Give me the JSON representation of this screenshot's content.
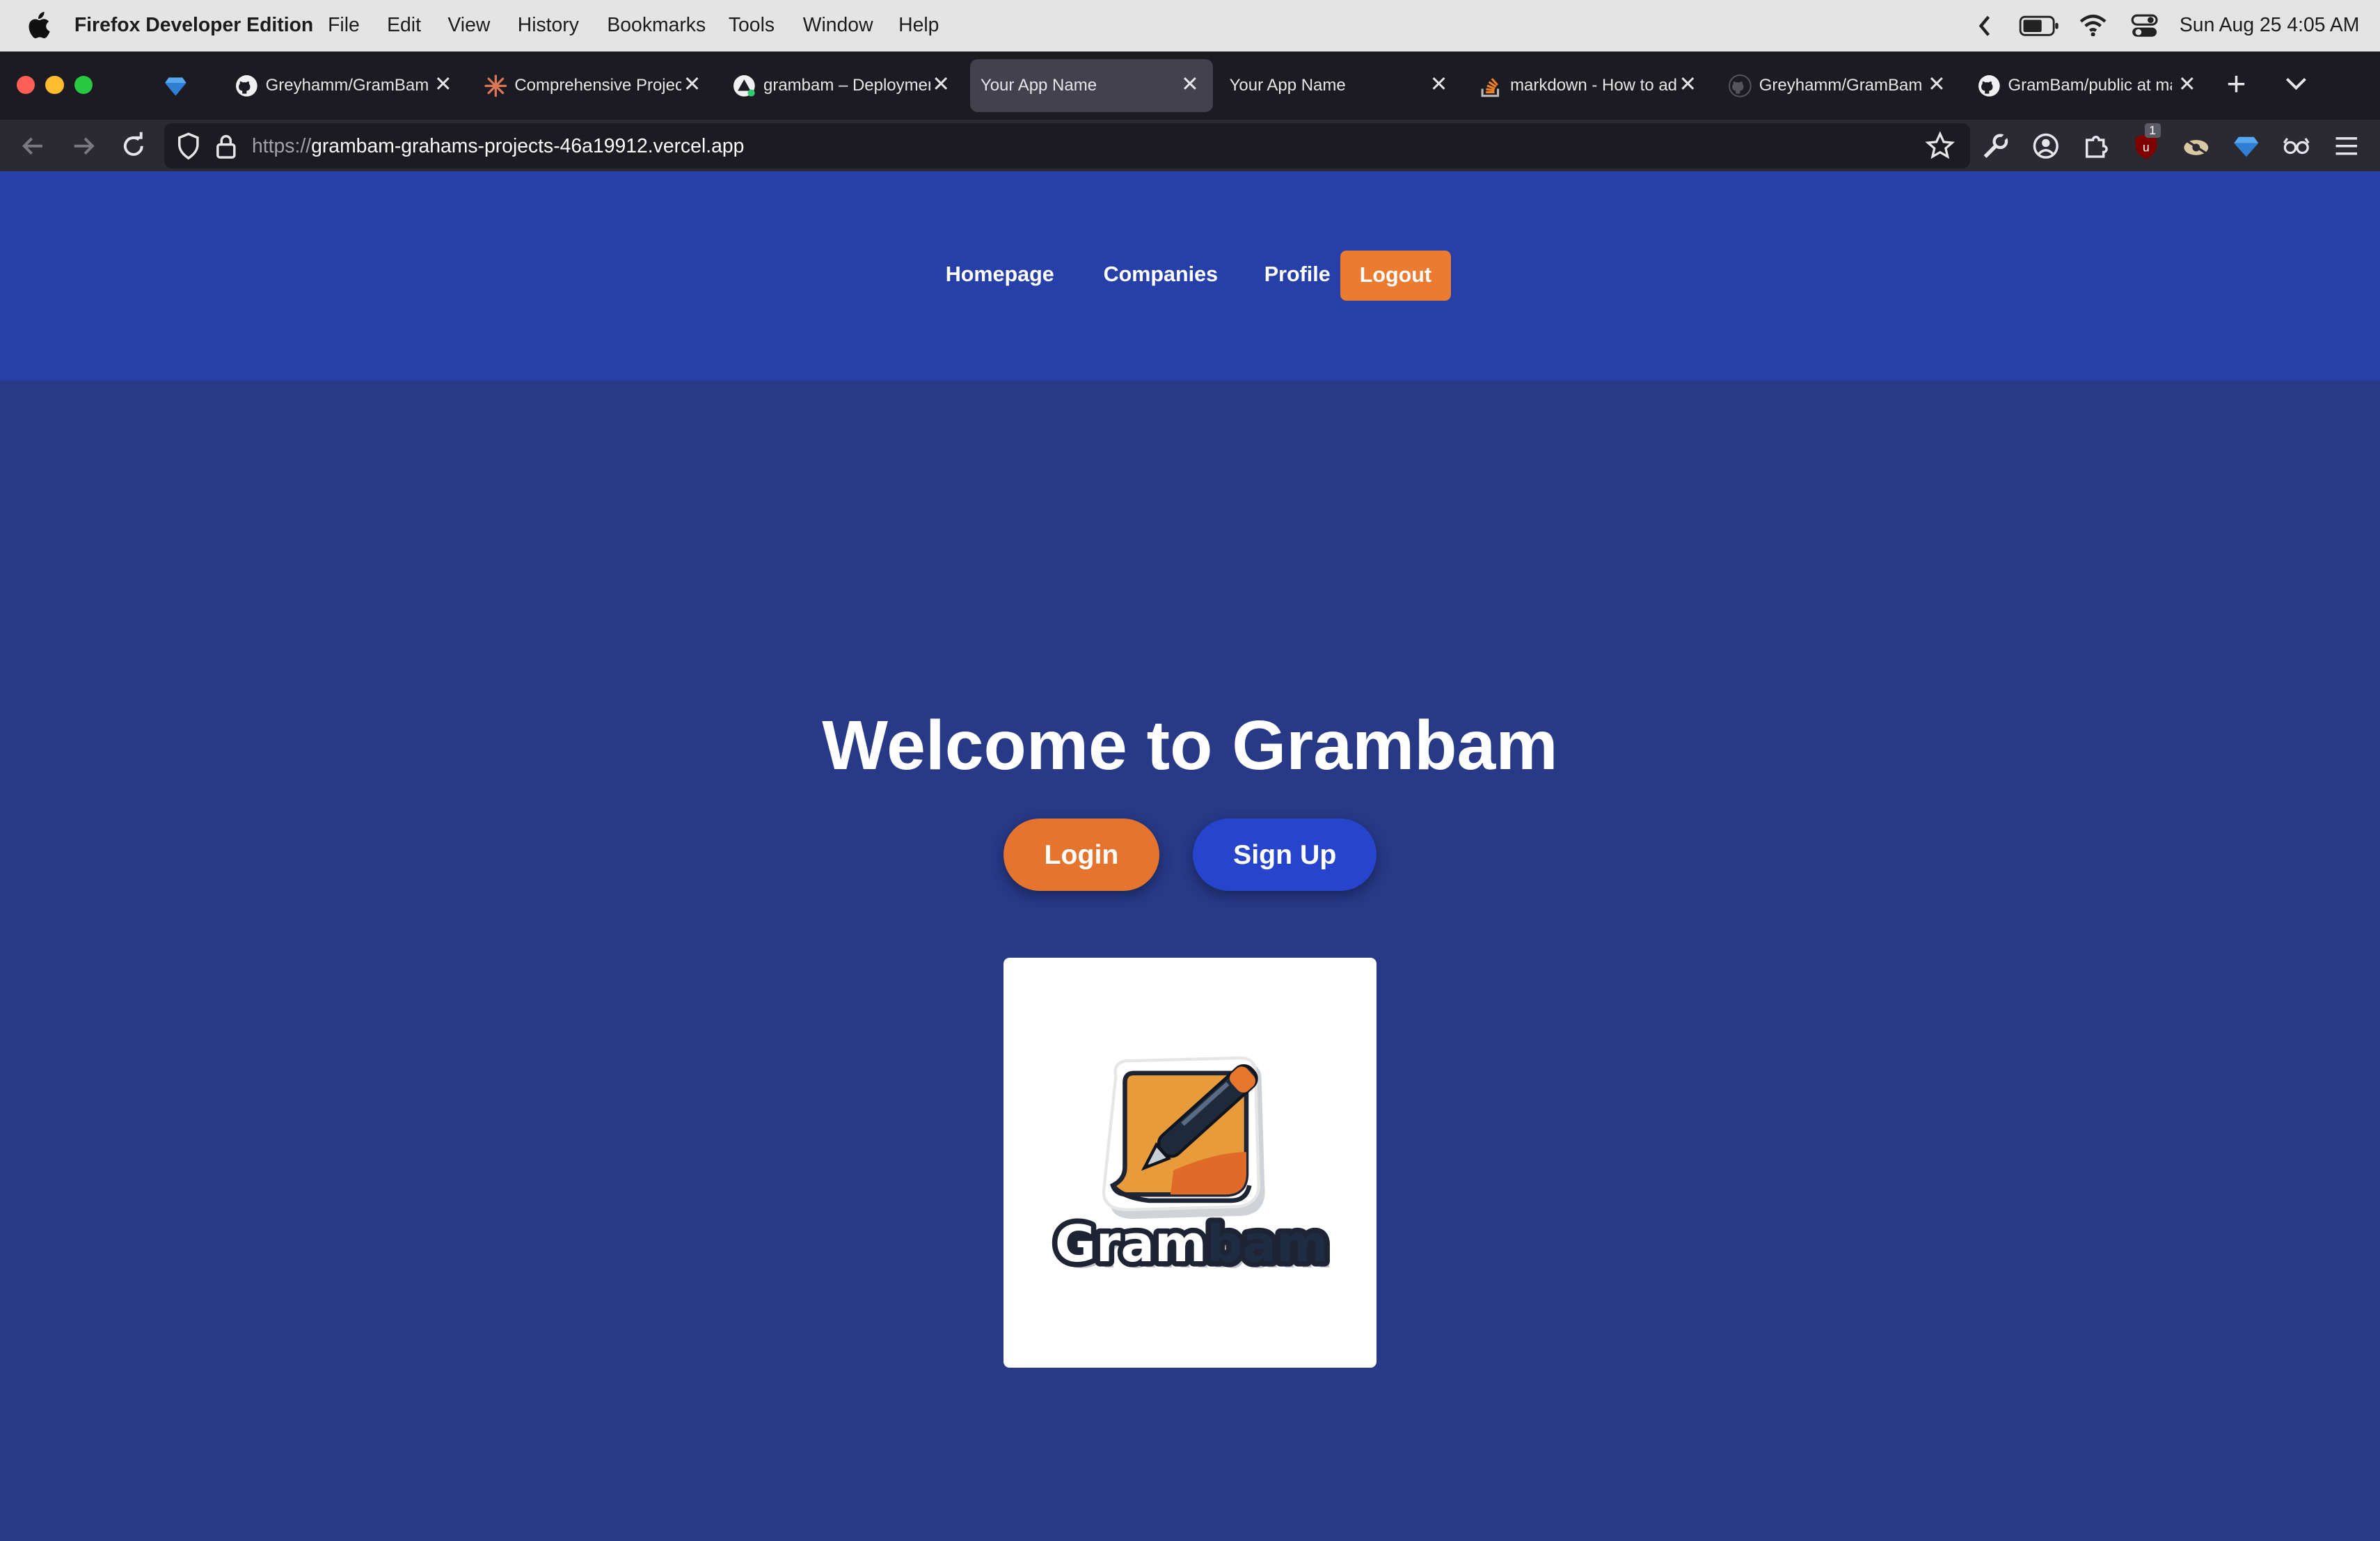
{
  "menubar": {
    "app_name": "Firefox Developer Edition",
    "items": [
      "File",
      "Edit",
      "View",
      "History",
      "Bookmarks",
      "Tools",
      "Window",
      "Help"
    ],
    "clock": "Sun Aug 25  4:05 AM"
  },
  "tabs": [
    {
      "label": "",
      "icon": "gem-icon",
      "active": false
    },
    {
      "label": "Greyhamm/GramBam",
      "icon": "github-icon",
      "active": false
    },
    {
      "label": "Comprehensive Project",
      "icon": "sparkle-icon",
      "active": false
    },
    {
      "label": "grambam – Deployment",
      "icon": "vercel-icon",
      "active": false
    },
    {
      "label": "Your App Name",
      "icon": "",
      "active": true
    },
    {
      "label": "Your App Name",
      "icon": "",
      "active": false
    },
    {
      "label": "markdown - How to add",
      "icon": "stackoverflow-icon",
      "active": false
    },
    {
      "label": "Greyhamm/GramBam",
      "icon": "github-icon",
      "active": false
    },
    {
      "label": "GramBam/public at main",
      "icon": "github-icon",
      "active": false
    }
  ],
  "urlbar": {
    "protocol": "https://",
    "host": "grambam-grahams-projects-46a19912.vercel.app"
  },
  "extension_badge": "1",
  "site": {
    "nav": {
      "homepage": "Homepage",
      "companies": "Companies",
      "profile": "Profile",
      "logout": "Logout"
    },
    "hero_title": "Welcome to Grambam",
    "login_label": "Login",
    "signup_label": "Sign Up",
    "logo_text": "Grambam"
  },
  "colors": {
    "header_bg": "#263fa9",
    "page_bg": "#273987",
    "accent_orange": "#e4742e",
    "signup_blue": "#2745cc"
  }
}
